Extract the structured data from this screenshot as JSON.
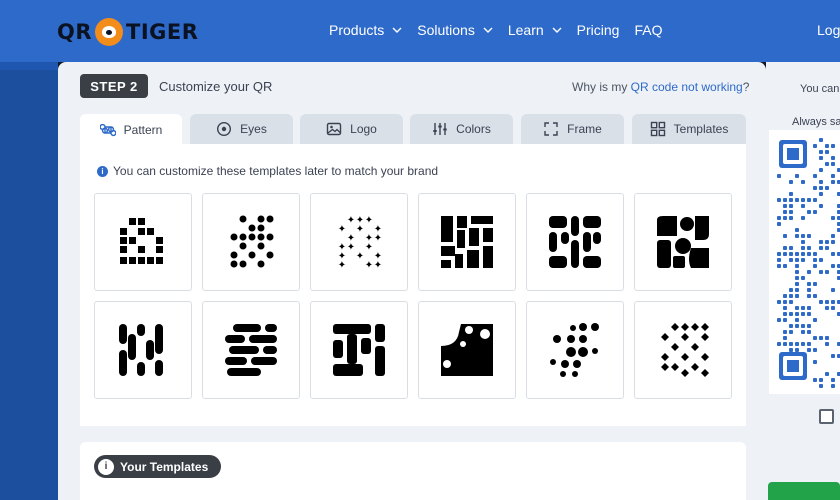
{
  "brand": {
    "left": "QR",
    "right": "TIGER"
  },
  "nav": {
    "products": "Products",
    "solutions": "Solutions",
    "learn": "Learn",
    "pricing": "Pricing",
    "faq": "FAQ",
    "login": "Log"
  },
  "step": {
    "badge": "STEP 2",
    "title": "Customize your QR"
  },
  "help": {
    "prefix": "Why is my ",
    "link": "QR code not working",
    "suffix": "?"
  },
  "tabs": [
    {
      "label": "Pattern",
      "icon": "command-icon"
    },
    {
      "label": "Eyes",
      "icon": "eye-icon"
    },
    {
      "label": "Logo",
      "icon": "image-icon"
    },
    {
      "label": "Colors",
      "icon": "sliders-icon"
    },
    {
      "label": "Frame",
      "icon": "frame-icon"
    },
    {
      "label": "Templates",
      "icon": "grid-icon"
    }
  ],
  "info": "You can customize these templates later to match your brand",
  "your_templates": "Your Templates",
  "right": {
    "text1": "You can",
    "text2": "Always sa"
  },
  "colors": {
    "accent": "#2e6ac9",
    "dark": "#3a3f46",
    "green": "#22a249"
  }
}
